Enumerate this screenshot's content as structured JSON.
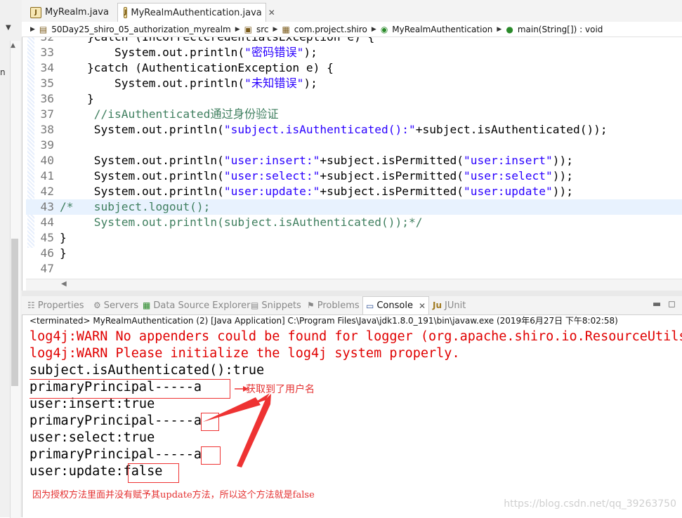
{
  "left_strip": {
    "label": "n"
  },
  "editor_tabs": [
    {
      "label": "MyRealm.java",
      "active": false
    },
    {
      "label": "MyRealmAuthentication.java",
      "active": true,
      "close": "✕"
    }
  ],
  "breadcrumb": {
    "project": "50Day25_shiro_05_authorization_myrealm",
    "folder": "src",
    "package": "com.project.shiro",
    "class": "MyRealmAuthentication",
    "method": "main(String[]) : void"
  },
  "code_lines": [
    {
      "n": "32",
      "text": "    }catch (IncorrectCredentialsException e) {"
    },
    {
      "n": "33",
      "text": "        System.out.println(\"密码错误\");"
    },
    {
      "n": "34",
      "text": "    }catch (AuthenticationException e) {"
    },
    {
      "n": "35",
      "text": "        System.out.println(\"未知错误\");"
    },
    {
      "n": "36",
      "text": "    }"
    },
    {
      "n": "37",
      "text": "     //isAuthenticated通过身份验证"
    },
    {
      "n": "38",
      "text": "     System.out.println(\"subject.isAuthenticated():\"+subject.isAuthenticated());"
    },
    {
      "n": "39",
      "text": ""
    },
    {
      "n": "40",
      "text": "     System.out.println(\"user:insert:\"+subject.isPermitted(\"user:insert\"));"
    },
    {
      "n": "41",
      "text": "     System.out.println(\"user:select:\"+subject.isPermitted(\"user:select\"));"
    },
    {
      "n": "42",
      "text": "     System.out.println(\"user:update:\"+subject.isPermitted(\"user:update\"));"
    },
    {
      "n": "43",
      "text": "/*   subject.logout();"
    },
    {
      "n": "44",
      "text": "     System.out.println(subject.isAuthenticated());*/"
    },
    {
      "n": "45",
      "text": "}"
    },
    {
      "n": "46",
      "text": "}"
    },
    {
      "n": "47",
      "text": ""
    }
  ],
  "view_tabs": [
    {
      "label": "Properties",
      "icon": "☷"
    },
    {
      "label": "Servers",
      "icon": "⚙"
    },
    {
      "label": "Data Source Explorer",
      "icon": "▦"
    },
    {
      "label": "Snippets",
      "icon": "▤"
    },
    {
      "label": "Problems",
      "icon": "⚑"
    },
    {
      "label": "Console",
      "icon": "▭",
      "active": true,
      "close": "✕"
    },
    {
      "label": "JUnit",
      "icon": "Ju"
    }
  ],
  "view_controls": {
    "minimize": "▬",
    "maximize": "◻"
  },
  "launch_info": "<terminated> MyRealmAuthentication (2) [Java Application] C:\\Program Files\\Java\\jdk1.8.0_191\\bin\\javaw.exe (2019年6月27日 下午8:02:58)",
  "console_lines": [
    {
      "text": "log4j:WARN No appenders could be found for logger (org.apache.shiro.io.ResourceUtils).",
      "error": true
    },
    {
      "text": "log4j:WARN Please initialize the log4j system properly.",
      "error": true
    },
    {
      "text": "subject.isAuthenticated():true",
      "error": false
    },
    {
      "text": "primaryPrincipal-----a",
      "error": false
    },
    {
      "text": "user:insert:true",
      "error": false
    },
    {
      "text": "primaryPrincipal-----a",
      "error": false
    },
    {
      "text": "user:select:true",
      "error": false
    },
    {
      "text": "primaryPrincipal-----a",
      "error": false
    },
    {
      "text": "user:update:false",
      "error": false
    }
  ],
  "annotations": {
    "username_note": "获取到了用户名",
    "bottom_note": "因为授权方法里面并没有赋予其update方法，所以这个方法就是false",
    "annotation_color": "#e33333"
  },
  "watermark": "https://blog.csdn.net/qq_39263750"
}
